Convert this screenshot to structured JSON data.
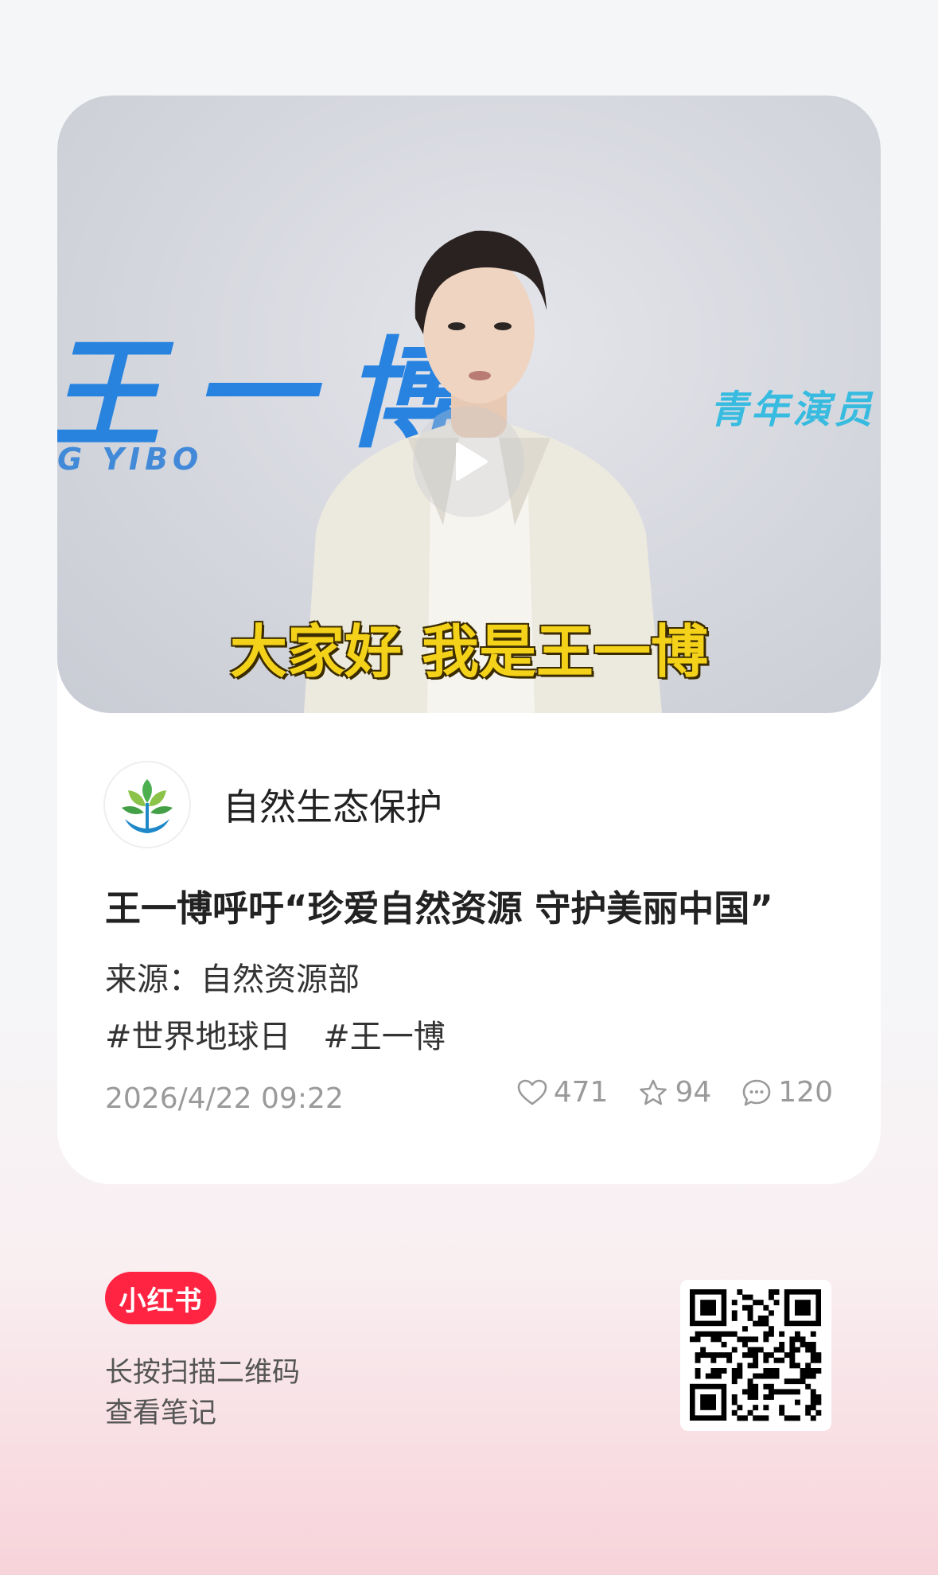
{
  "video": {
    "bg_name": "王一博",
    "bg_pinyin": "G YIBO",
    "bg_role": "青年演员",
    "subtitle": "大家好 我是王一博"
  },
  "author": {
    "name": "自然生态保护"
  },
  "note": {
    "title": "王一博呼吁“珍爱自然资源 守护美丽中国”",
    "source": "来源：自然资源部",
    "tags": [
      "#世界地球日",
      "#王一博"
    ],
    "time": "2026/4/22 09:22"
  },
  "stats": {
    "likes": "471",
    "collects": "94",
    "comments": "120"
  },
  "footer": {
    "brand": "小红书",
    "scan_line1": "长按扫描二维码",
    "scan_line2": "查看笔记"
  },
  "colors": {
    "brand": "#ff2442",
    "subtitle": "#f4d21a",
    "muted": "#9a9a9a"
  }
}
